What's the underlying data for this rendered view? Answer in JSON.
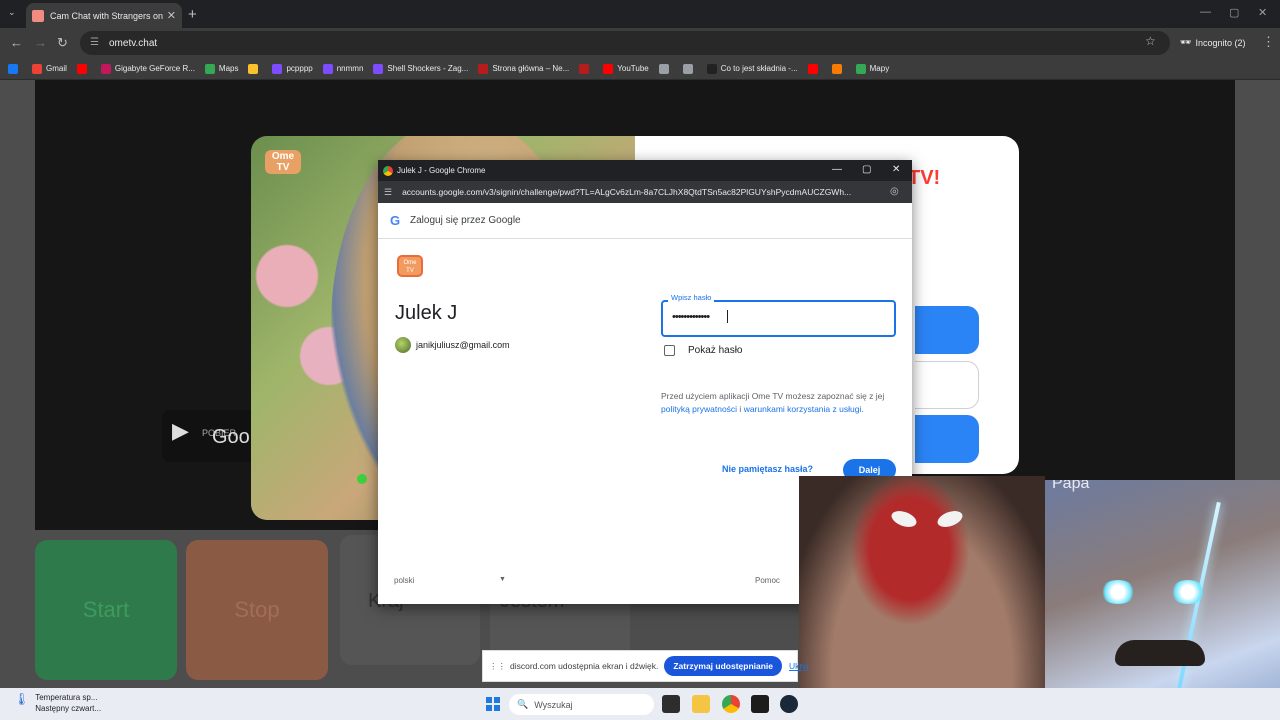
{
  "browser": {
    "tab_title": "Cam Chat with Strangers on Or",
    "new_tab": "+",
    "url": "ometv.chat",
    "incognito": "Incognito (2)"
  },
  "bookmarks": [
    {
      "label": "",
      "color": "#1877f2"
    },
    {
      "label": "Gmail",
      "color": "#ea4335"
    },
    {
      "label": "",
      "color": "#ff0000"
    },
    {
      "label": "Gigabyte GeForce R...",
      "color": "#c2185b"
    },
    {
      "label": "Maps",
      "color": "#34a853"
    },
    {
      "label": "",
      "color": "#fbc02d"
    },
    {
      "label": "pcpppp",
      "color": "#7c4dff"
    },
    {
      "label": "nnmmn",
      "color": "#7c4dff"
    },
    {
      "label": "Shell Shockers - Zag...",
      "color": "#7c4dff"
    },
    {
      "label": "Strona główna – Ne...",
      "color": "#b71c1c"
    },
    {
      "label": "",
      "color": "#b71c1c"
    },
    {
      "label": "YouTube",
      "color": "#ff0000"
    },
    {
      "label": "",
      "color": "#9aa0a6"
    },
    {
      "label": "",
      "color": "#9aa0a6"
    },
    {
      "label": "Co to jest składnia -...",
      "color": "#222222"
    },
    {
      "label": "",
      "color": "#ff0000"
    },
    {
      "label": "",
      "color": "#f57c00"
    },
    {
      "label": "Mapy",
      "color": "#34a853"
    }
  ],
  "page": {
    "promo_logo": "Ome TV",
    "promo_title_fragment": "TV!",
    "play_badge": "POBIER",
    "play_badge_big": "Goo",
    "start": "Start",
    "stop": "Stop",
    "kraj": "Kraj",
    "jestem": "Jestem"
  },
  "popup": {
    "window_title": "Julek J - Google Chrome",
    "url": "accounts.google.com/v3/signin/challenge/pwd?TL=ALgCv6zLm-8a7CLJhX8QtdTSn5ac82PlGUYshPycdmAUCZGWh...",
    "header": "Zaloguj się przez Google",
    "app_logo": "Ome TV",
    "user_name": "Julek J",
    "user_email": "janikjuliusz@gmail.com",
    "password_label": "Wpisz hasło",
    "password_value": "•••••••••••••",
    "show_password": "Pokaż hasło",
    "policy_prefix": "Przed użyciem aplikacji Ome TV możesz zapoznać się z jej ",
    "policy_link": "polityką prywatności",
    "policy_mid": " i ",
    "terms_link": "warunkami korzystania z usługi",
    "policy_suffix": ".",
    "forgot": "Nie pamiętasz hasła?",
    "next": "Dalej",
    "language": "polski",
    "help": "Pomoc"
  },
  "video": {
    "tile2_name": "Papa"
  },
  "sharebar": {
    "message": "discord.com udostępnia ekran i dźwięk.",
    "stop": "Zatrzymaj udostępnianie",
    "hide": "Ukryj"
  },
  "taskbar": {
    "weather_title": "Temperatura sp...",
    "weather_sub": "Następny czwart...",
    "search_placeholder": "Wyszukaj"
  }
}
